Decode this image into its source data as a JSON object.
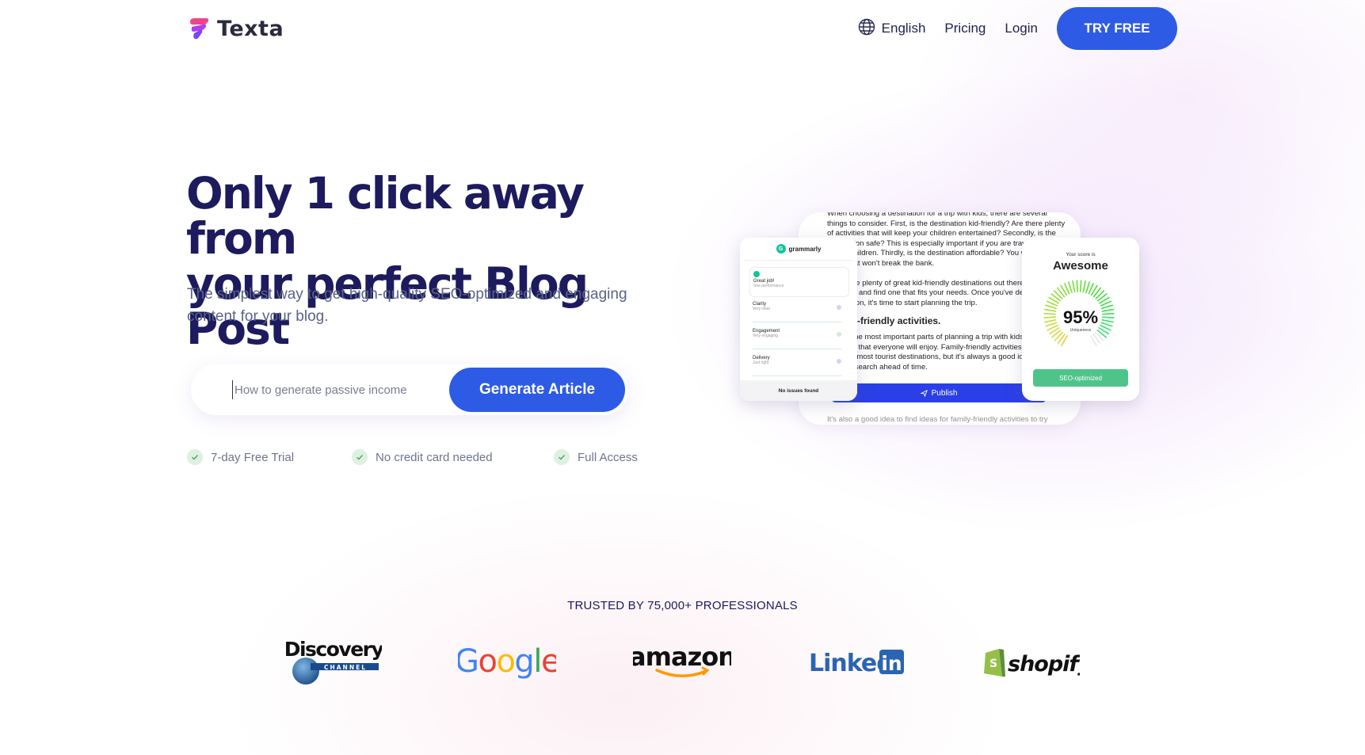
{
  "header": {
    "logo_text": "Texta",
    "language_label": "English",
    "nav": {
      "pricing": "Pricing",
      "login": "Login"
    },
    "cta_label": "TRY FREE"
  },
  "hero": {
    "title_line1": "Only 1 click away from",
    "title_line2": "your perfect Blog Post",
    "subtitle": "The simplest way to get high-quality SEO-optimized and engaging content for your blog.",
    "search_placeholder": "How to generate passive income",
    "generate_label": "Generate Article",
    "features": [
      "7-day Free Trial",
      "No credit card needed",
      "Full Access"
    ]
  },
  "mockup": {
    "doc_paragraphs": [
      "When choosing a destination for a trip with kids, there are several things to consider. First, is the destination kid-friendly? Are there plenty of activities that will keep your children entertained? Secondly, is the destination safe? This is especially important if you are traveling with young children. Thirdly, is the destination affordable? You want to find a place that won't break the bank.",
      "There are plenty of great kid-friendly destinations out there. Do your research and find one that fits your needs. Once you've decided on a destination, it's time to start planning the trip."
    ],
    "doc_heading": "Family-friendly activities.",
    "doc_paragraph3": "One of the most important parts of planning a trip with kids is finding activities that everyone will enjoy. Family-friendly activities can be found at most tourist destinations, but it's always a good idea to do some research ahead of time.",
    "doc_tail": "It's also a good idea to find ideas for family-friendly activities to try",
    "publish_label": "Publish",
    "grammarly": {
      "brand": "grammarly",
      "items": [
        {
          "title": "Great job!",
          "sub": "See performance"
        },
        {
          "title": "Clarity",
          "sub": "Very clear"
        },
        {
          "title": "Engagement",
          "sub": "Very engaging"
        },
        {
          "title": "Delivery",
          "sub": "Just right"
        }
      ],
      "footer": "No issues found"
    },
    "score": {
      "caption": "Your score is",
      "rating": "Awesome",
      "percent": "95%",
      "percent_value": 95,
      "percent_sub": "Uniqueness",
      "badge": "SEO-optimized"
    }
  },
  "trusted": {
    "label": "TRUSTED BY 75,000+ PROFESSIONALS",
    "brands": {
      "discovery": "Discovery",
      "discovery_sub": "CHANNEL",
      "google": "Google",
      "amazon": "amazon",
      "linkedin": "Linked",
      "linkedin_in": "in",
      "shopify": "shopify"
    }
  },
  "colors": {
    "primary": "#2e5be6",
    "heading": "#1d1b5e",
    "muted": "#5b6289",
    "success": "#4fc48a"
  }
}
